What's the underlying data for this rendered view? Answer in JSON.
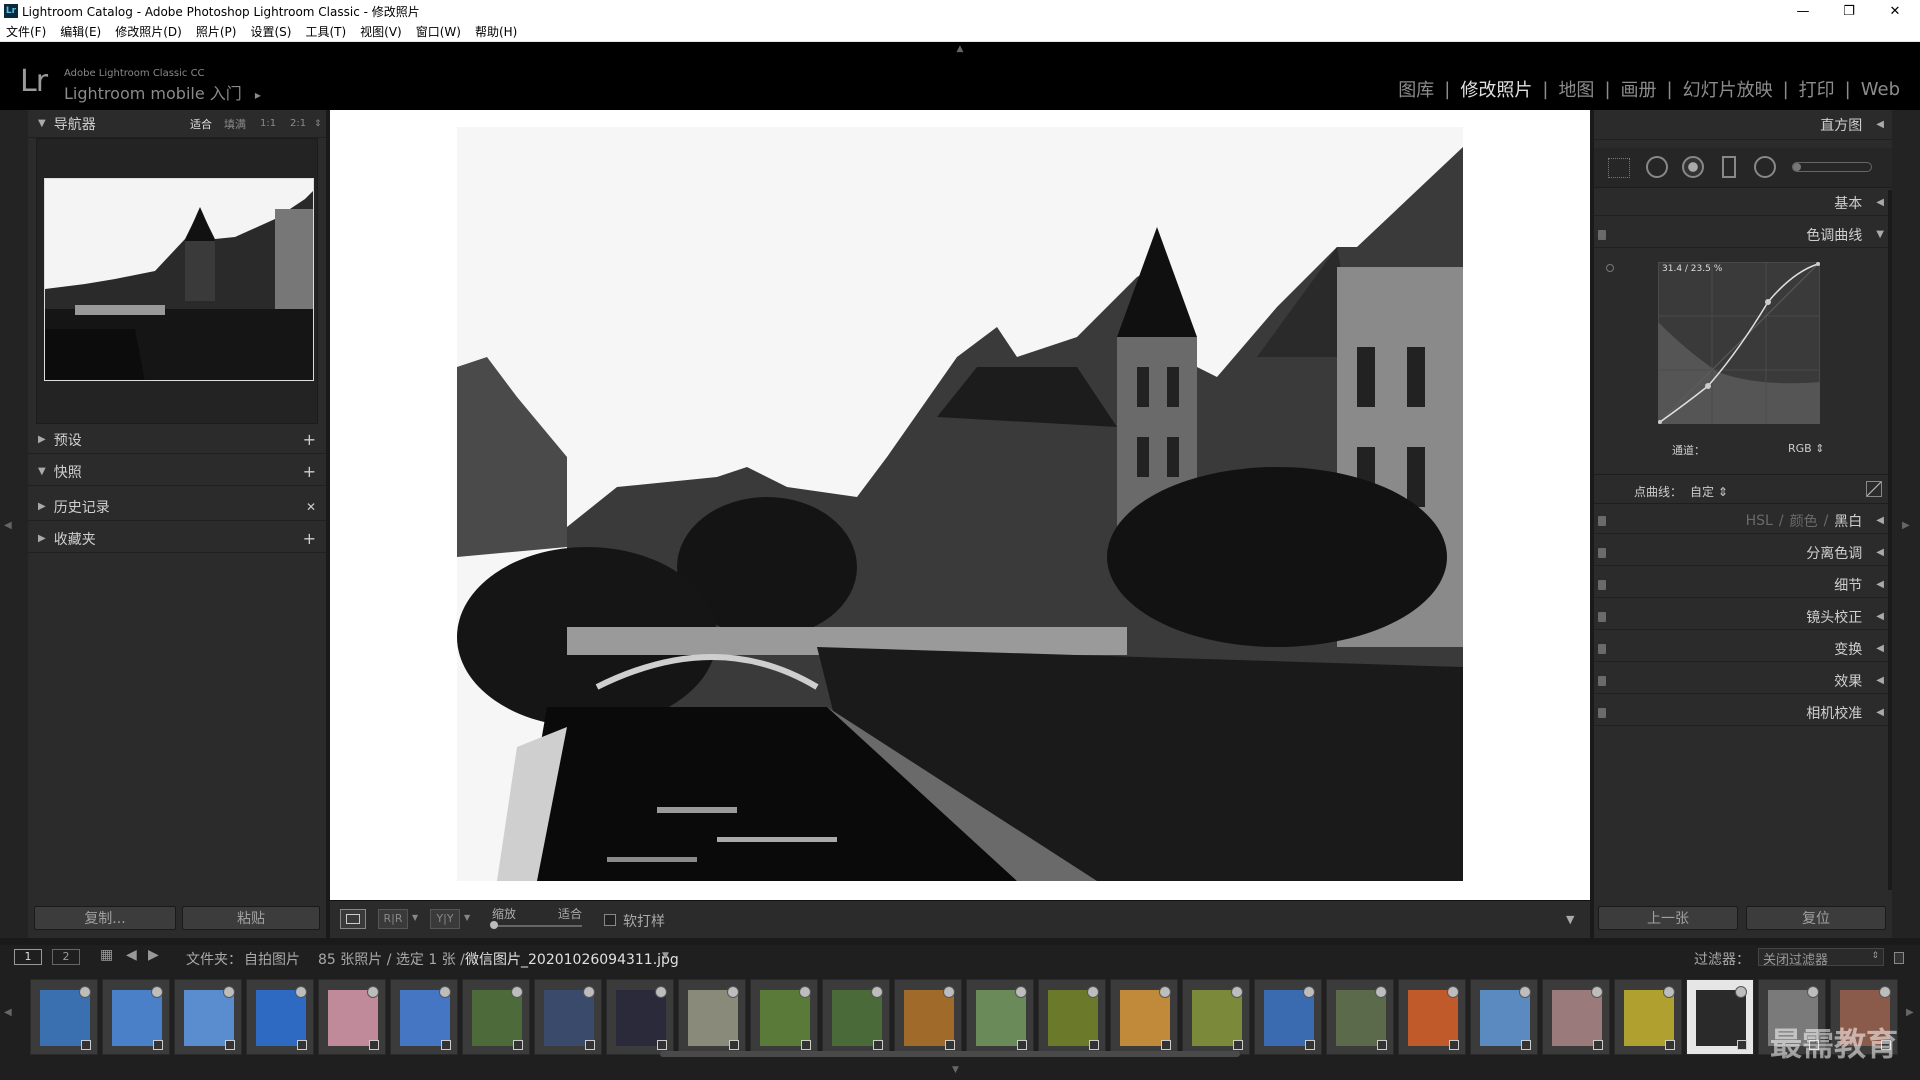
{
  "window": {
    "title": "Lightroom Catalog - Adobe Photoshop Lightroom Classic - 修改照片",
    "icon": "Lr",
    "controls": {
      "minimize": "—",
      "restore": "❐",
      "close": "✕"
    }
  },
  "menu": [
    "文件(F)",
    "编辑(E)",
    "修改照片(D)",
    "照片(P)",
    "设置(S)",
    "工具(T)",
    "视图(V)",
    "窗口(W)",
    "帮助(H)"
  ],
  "identity": {
    "logo": "Lr",
    "product": "Adobe Lightroom Classic CC",
    "mobile": "Lightroom mobile 入门",
    "mobile_arrow": "▸"
  },
  "modules": [
    {
      "label": "图库",
      "active": false
    },
    {
      "label": "修改照片",
      "active": true
    },
    {
      "label": "地图",
      "active": false
    },
    {
      "label": "画册",
      "active": false
    },
    {
      "label": "幻灯片放映",
      "active": false
    },
    {
      "label": "打印",
      "active": false
    },
    {
      "label": "Web",
      "active": false
    }
  ],
  "left_panel": {
    "navigator": {
      "title": "导航器",
      "zoom_options": [
        "适合",
        "填满",
        "1:1",
        "2:1"
      ],
      "zoom_stepper": "⇕"
    },
    "sections": [
      {
        "label": "预设",
        "action": "+"
      },
      {
        "label": "快照",
        "action": "+"
      },
      {
        "label": "历史记录",
        "action": "✕"
      },
      {
        "label": "收藏夹",
        "action": "+"
      }
    ],
    "copy_button": "复制...",
    "paste_button": "粘贴"
  },
  "right_panel": {
    "histogram_title": "直方图",
    "basic_title": "基本",
    "tone_curve": {
      "title": "色调曲线",
      "readout": "31.4 / 23.5 %",
      "channel_label": "通道：",
      "channel_value": "RGB ⇕",
      "point_curve_label": "点曲线：",
      "point_curve_value": "自定 ⇕"
    },
    "hsl": {
      "hsl": "HSL",
      "color": "颜色",
      "bw": "黑白"
    },
    "sections": [
      "分离色调",
      "细节",
      "镜头校正",
      "变换",
      "效果",
      "相机校准"
    ],
    "prev_button": "上一张",
    "reset_button": "复位"
  },
  "toolbar": {
    "zoom_label": "缩放",
    "fit_label": "适合",
    "soft_proof": "软打样",
    "compare_rr": "R|R",
    "compare_yy": "Y|Y"
  },
  "filmstrip_bar": {
    "view1": "1",
    "view2": "2",
    "source_prefix": "文件夹：",
    "source": "自拍图片",
    "count": "85 张照片 / 选定 1 张 /",
    "filename": "微信图片_20201026094311.jpg",
    "filter_label": "过滤器：",
    "filter_value": "关闭过滤器"
  },
  "watermark": "最需教育",
  "colors": {
    "accent": "#e0e0e0",
    "panel": "#2b2b2b",
    "background": "#1a1a1a"
  }
}
